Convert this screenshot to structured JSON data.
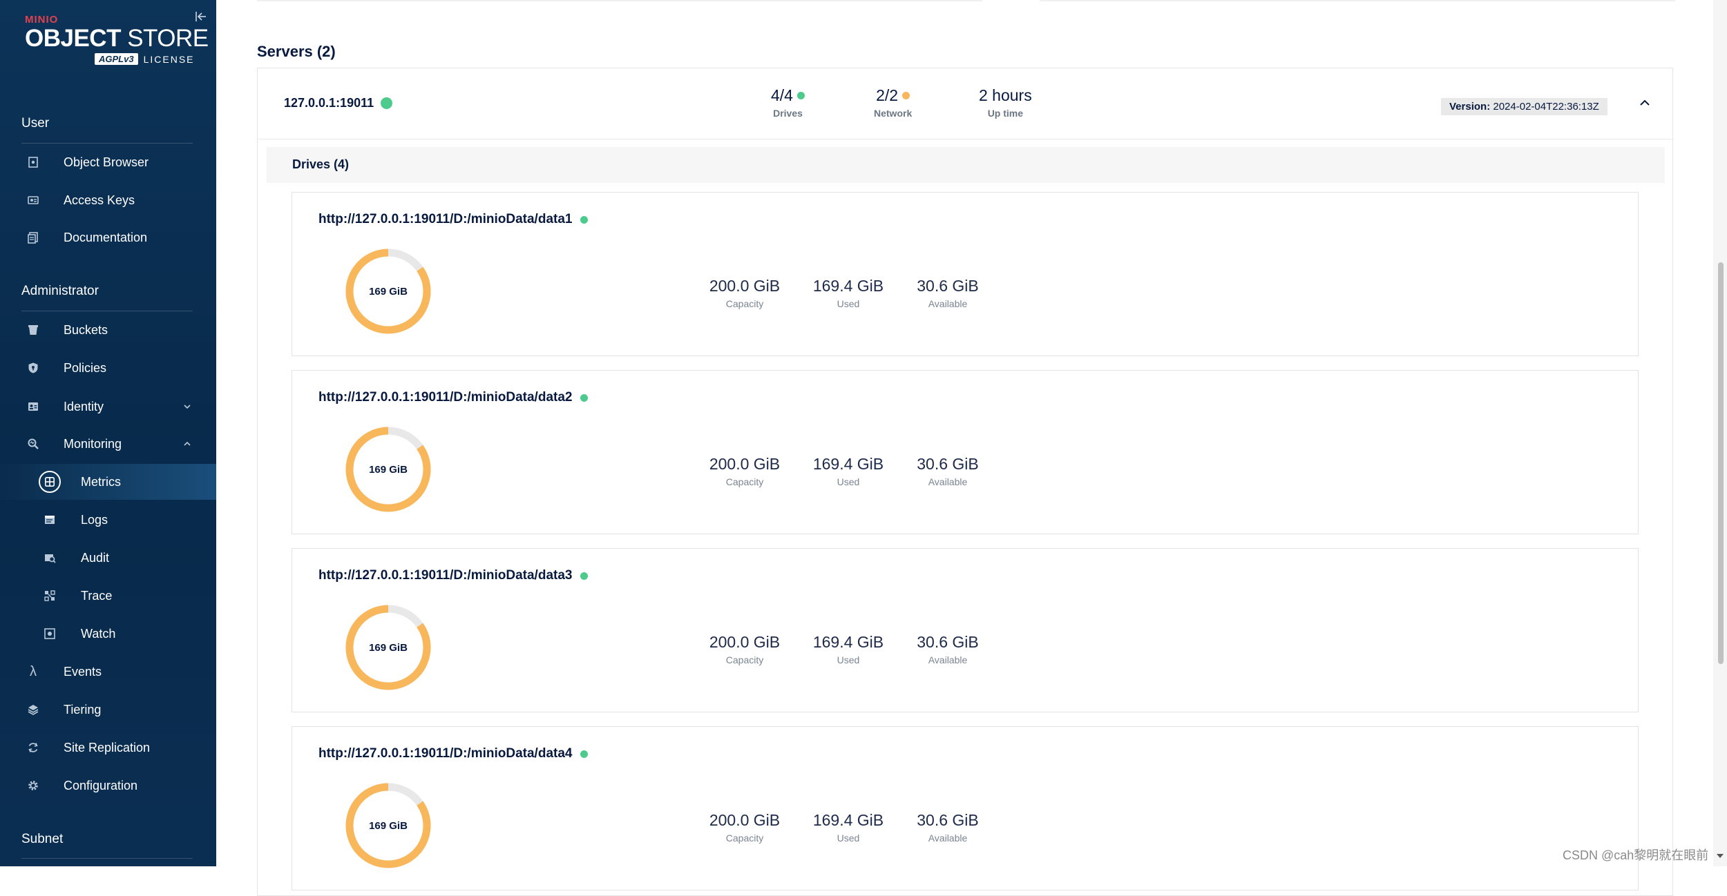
{
  "sidebar": {
    "logo": {
      "brand": "MINIO",
      "title_bold": "OBJECT",
      "title_rest": "STORE",
      "agpl": "AGPLv3",
      "license": "LICENSE"
    },
    "sections": {
      "user": "User",
      "administrator": "Administrator",
      "subnet": "Subnet"
    },
    "user_items": [
      {
        "label": "Object Browser",
        "icon": "object-browser-icon"
      },
      {
        "label": "Access Keys",
        "icon": "access-keys-icon"
      },
      {
        "label": "Documentation",
        "icon": "documentation-icon"
      }
    ],
    "admin_items": [
      {
        "label": "Buckets",
        "icon": "buckets-icon"
      },
      {
        "label": "Policies",
        "icon": "policies-icon"
      },
      {
        "label": "Identity",
        "icon": "identity-icon"
      },
      {
        "label": "Monitoring",
        "icon": "monitoring-icon"
      },
      {
        "label": "Metrics",
        "icon": "metrics-icon",
        "active": true
      },
      {
        "label": "Logs",
        "icon": "logs-icon"
      },
      {
        "label": "Audit",
        "icon": "audit-icon"
      },
      {
        "label": "Trace",
        "icon": "trace-icon"
      },
      {
        "label": "Watch",
        "icon": "watch-icon"
      },
      {
        "label": "Events",
        "icon": "lambda-icon"
      },
      {
        "label": "Tiering",
        "icon": "tiering-icon"
      },
      {
        "label": "Site Replication",
        "icon": "site-replication-icon"
      },
      {
        "label": "Configuration",
        "icon": "configuration-icon"
      }
    ]
  },
  "main": {
    "servers_title": "Servers (2)",
    "server": {
      "name": "127.0.0.1:19011",
      "status_color": "#4ccb8d",
      "drives_value": "4/4",
      "drives_label": "Drives",
      "network_value": "2/2",
      "network_label": "Network",
      "uptime_value": "2 hours",
      "uptime_label": "Up time",
      "version_label": "Version:",
      "version_value": "2024-02-04T22:36:13Z",
      "drives_section_title": "Drives (4)"
    },
    "drives": [
      {
        "url": "http://127.0.0.1:19011/D:/minioData/data1",
        "donut_label": "169 GiB",
        "used_fraction": 0.847,
        "capacity": "200.0 GiB",
        "capacity_label": "Capacity",
        "used": "169.4 GiB",
        "used_label": "Used",
        "available": "30.6 GiB",
        "available_label": "Available"
      },
      {
        "url": "http://127.0.0.1:19011/D:/minioData/data2",
        "donut_label": "169 GiB",
        "used_fraction": 0.847,
        "capacity": "200.0 GiB",
        "capacity_label": "Capacity",
        "used": "169.4 GiB",
        "used_label": "Used",
        "available": "30.6 GiB",
        "available_label": "Available"
      },
      {
        "url": "http://127.0.0.1:19011/D:/minioData/data3",
        "donut_label": "169 GiB",
        "used_fraction": 0.847,
        "capacity": "200.0 GiB",
        "capacity_label": "Capacity",
        "used": "169.4 GiB",
        "used_label": "Used",
        "available": "30.6 GiB",
        "available_label": "Available"
      },
      {
        "url": "http://127.0.0.1:19011/D:/minioData/data4",
        "donut_label": "169 GiB",
        "used_fraction": 0.847,
        "capacity": "200.0 GiB",
        "capacity_label": "Capacity",
        "used": "169.4 GiB",
        "used_label": "Used",
        "available": "30.6 GiB",
        "available_label": "Available"
      }
    ]
  },
  "colors": {
    "ok": "#4ccb8d",
    "warn": "#f9b75c",
    "donut_track": "#e8e8e8",
    "sidebar_bg": "#0b3055"
  },
  "watermark": "CSDN @cah黎明就在眼前"
}
